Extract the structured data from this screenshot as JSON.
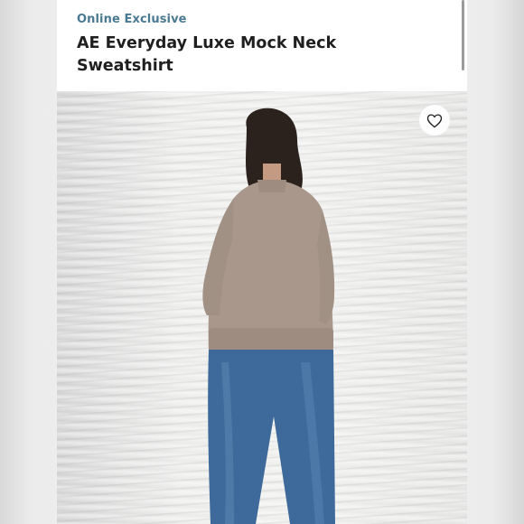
{
  "product": {
    "badge": "Online Exclusive",
    "title": "AE Everyday Luxe Mock Neck Sweatshirt"
  },
  "image": {
    "subject": "model-back-view",
    "favorite_icon": "heart-icon"
  },
  "colors": {
    "badge": "#4a7a91",
    "title": "#1f1f1f",
    "sweatshirt": "#a8978a",
    "jeans": "#3d6a9a"
  }
}
